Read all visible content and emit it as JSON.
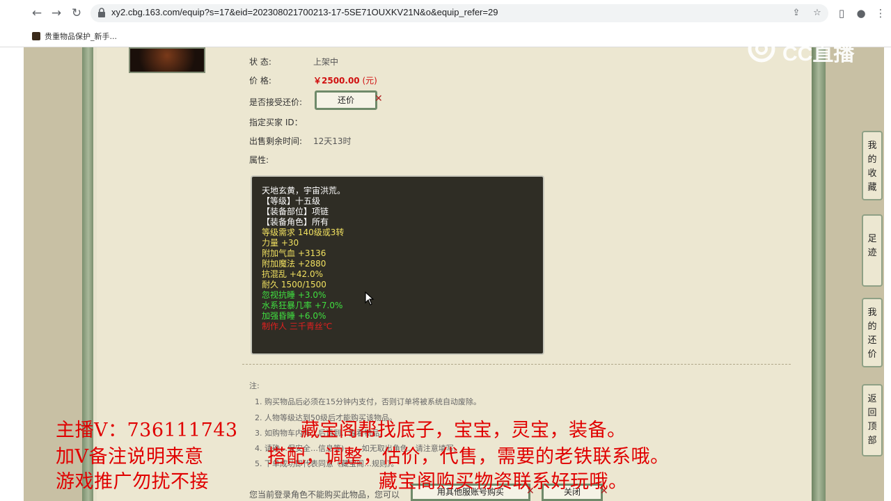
{
  "browser": {
    "url": "xy2.cbg.163.com/equip?s=17&eid=202308021700213-17-5SE71OUXKV21N&o&equip_refer=29",
    "bookmark_label": "贵重物品保护_新手..."
  },
  "item": {
    "status_label": "状 态:",
    "status_value": "上架中",
    "price_label": "价 格:",
    "price_value": "￥2500.00",
    "price_unit": "(元)",
    "bargain_label": "是否接受还价:",
    "bargain_button": "还价",
    "buyer_label": "指定买家 ID：",
    "time_label": "出售剩余时间:",
    "time_value": "12天13时",
    "attr_label": "属性:"
  },
  "attributes": [
    {
      "text": "天地玄黄，宇宙洪荒。",
      "color": "#ffffff"
    },
    {
      "text": "【等级】十五级",
      "color": "#ffffff"
    },
    {
      "text": "【装备部位】项链",
      "color": "#ffffff"
    },
    {
      "text": "【装备角色】所有",
      "color": "#ffffff"
    },
    {
      "text": "等级需求 140级或3转",
      "color": "#f0e060"
    },
    {
      "text": "力量 +30",
      "color": "#f0e060"
    },
    {
      "text": "附加气血 +3136",
      "color": "#f0e060"
    },
    {
      "text": "附加魔法 +2880",
      "color": "#f0e060"
    },
    {
      "text": "抗混乱 +42.0%",
      "color": "#f0e060"
    },
    {
      "text": "耐久 1500/1500",
      "color": "#f0e060"
    },
    {
      "text": "忽视抗睡 +3.0%",
      "color": "#40e040"
    },
    {
      "text": "水系狂暴几率 +7.0%",
      "color": "#40e040"
    },
    {
      "text": "加强昏睡 +6.0%",
      "color": "#40e040"
    },
    {
      "text": "制作人 三千青丝℃",
      "color": "#e02020"
    }
  ],
  "notes": {
    "title": "注:",
    "items": [
      "1. 购买物品后必须在15分钟内支付，否则订单将被系统自动废除。",
      "2. 人物等级达到50级后才能购买该物品。",
      "3. 如购物车内有…后请到…查看物品。",
      "4. 请确…保安全…信息等)，… 如无取出角色…请注意填写。",
      "5. 下单成功即代表同意《藏宝阁…规则》。"
    ]
  },
  "bottom": {
    "login_text": "您当前登录角色不能购买此物品，您可以",
    "other_server_button": "用其他服账号购买",
    "close_button": "关闭"
  },
  "side_tabs": {
    "favorites": "我的收藏",
    "footprints": "足迹",
    "my_bargains": "我的还价",
    "back_to_top": "返回顶部"
  },
  "watermark": "CC直播",
  "overlay": {
    "line1_left": "主播V：736111743",
    "line1_right": "藏宝阁帮找底子，宝宝，灵宝，装备。",
    "line2_left": "加V备注说明来意",
    "line2_right": "搭配，调整，估价，代售，需要的老铁联系哦。",
    "line3_left": "游戏推广勿扰不接",
    "line3_right": "藏宝阁购买物资联系好玩哦。"
  }
}
